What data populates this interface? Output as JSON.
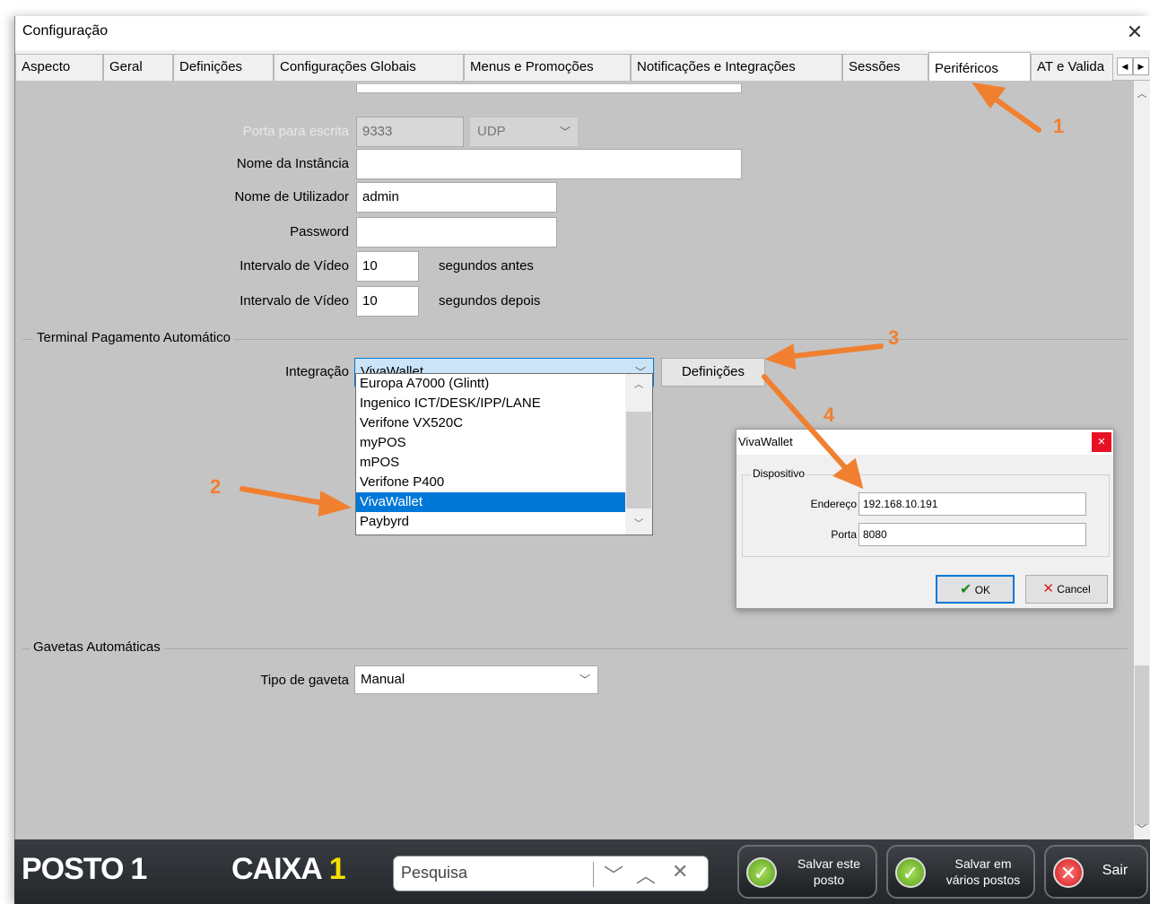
{
  "window": {
    "title": "Configuração"
  },
  "tabs": [
    {
      "label": "Aspecto"
    },
    {
      "label": "Geral"
    },
    {
      "label": "Definições"
    },
    {
      "label": "Configurações Globais"
    },
    {
      "label": "Menus e Promoções"
    },
    {
      "label": "Notificações e Integrações"
    },
    {
      "label": "Sessões"
    },
    {
      "label": "Periféricos"
    },
    {
      "label": "AT e Valida"
    }
  ],
  "camera": {
    "write_port_label": "Porta para escrita",
    "write_port_value": "9333",
    "protocol_value": "UDP",
    "instance_label": "Nome da Instância",
    "instance_value": "",
    "user_label": "Nome de Utilizador",
    "user_value": "admin",
    "password_label": "Password",
    "password_value": "",
    "video_before_label": "Intervalo de Vídeo",
    "video_before_value": "10",
    "video_before_suffix": "segundos antes",
    "video_after_label": "Intervalo de Vídeo",
    "video_after_value": "10",
    "video_after_suffix": "segundos depois"
  },
  "payment_terminal": {
    "group_title": "Terminal Pagamento Automático",
    "integration_label": "Integração",
    "integration_value": "VivaWallet",
    "settings_button": "Definições",
    "options": [
      "Europa A7000 (Glintt)",
      "Ingenico ICT/DESK/IPP/LANE",
      "Verifone VX520C",
      "myPOS",
      "mPOS",
      "Verifone P400",
      "VivaWallet",
      "Paybyrd"
    ],
    "selected_index": 6
  },
  "drawers": {
    "group_title": "Gavetas Automáticas",
    "type_label": "Tipo de gaveta",
    "type_value": "Manual"
  },
  "dialog": {
    "title": "VivaWallet",
    "group_title": "Dispositivo",
    "address_label": "Endereço",
    "address_value": "192.168.10.191",
    "port_label": "Porta",
    "port_value": "8080",
    "ok_label": "OK",
    "cancel_label": "Cancel"
  },
  "annotations": [
    "1",
    "2",
    "3",
    "4"
  ],
  "bottom_bar": {
    "posto_label": "POSTO",
    "posto_number": "1",
    "caixa_label": "CAIXA",
    "caixa_number": "1",
    "search_placeholder": "Pesquisa",
    "save_this_line1": "Salvar este",
    "save_this_line2": "posto",
    "save_many_line1": "Salvar em",
    "save_many_line2": "vários postos",
    "exit_label": "Sair"
  },
  "colors": {
    "annotation": "#f08030",
    "selection": "#0078d7",
    "caixa_number": "#f5e000",
    "panel_bg": "#c4c4c4"
  }
}
